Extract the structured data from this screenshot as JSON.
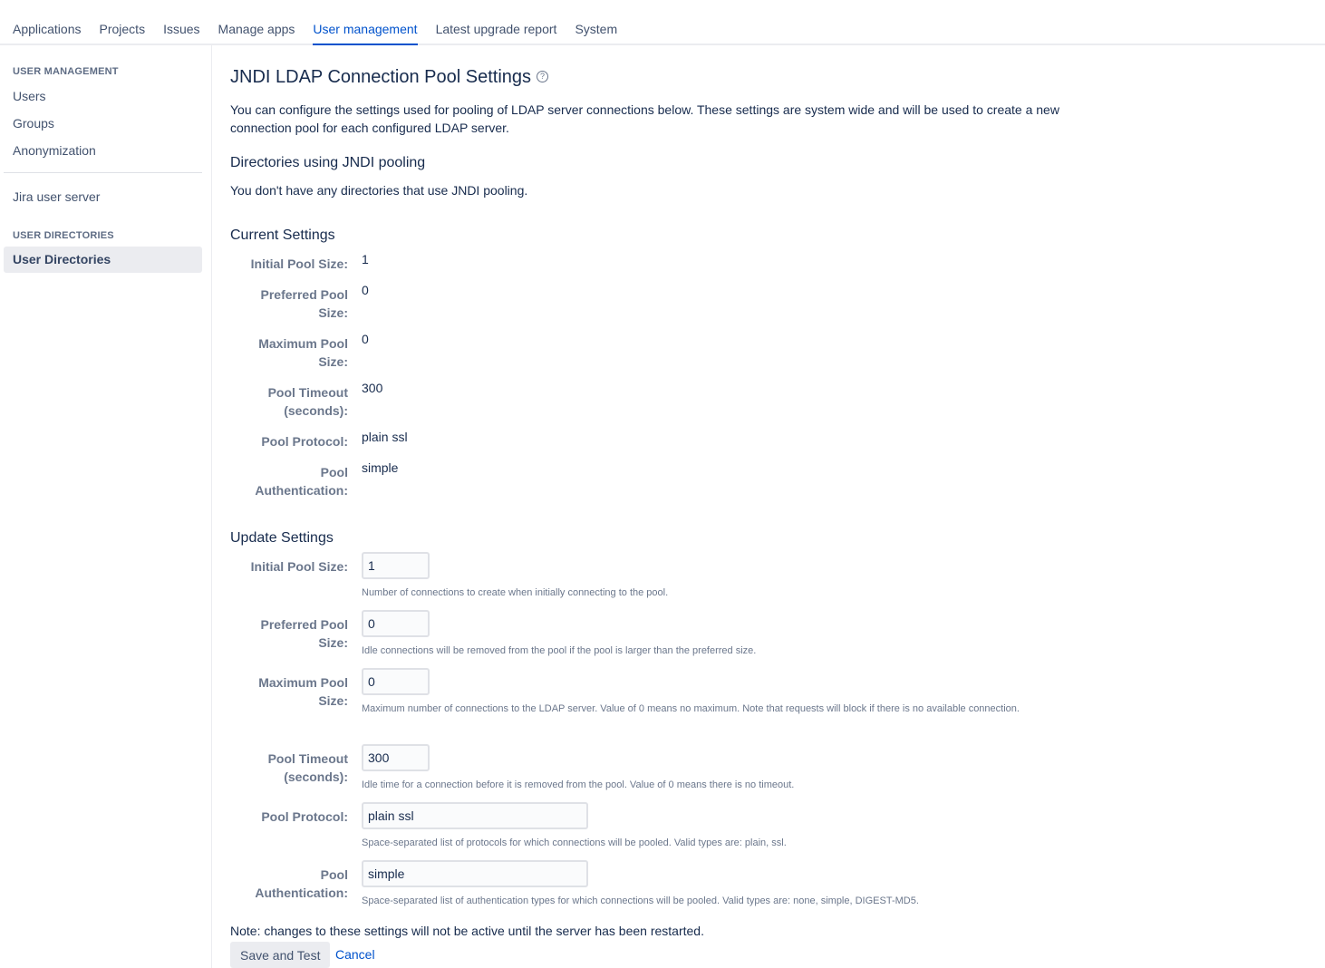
{
  "topnav": {
    "tabs": [
      {
        "label": "Applications",
        "active": false
      },
      {
        "label": "Projects",
        "active": false
      },
      {
        "label": "Issues",
        "active": false
      },
      {
        "label": "Manage apps",
        "active": false
      },
      {
        "label": "User management",
        "active": true
      },
      {
        "label": "Latest upgrade report",
        "active": false
      },
      {
        "label": "System",
        "active": false
      }
    ]
  },
  "sidebar": {
    "section1_heading": "USER MANAGEMENT",
    "items1": [
      "Users",
      "Groups",
      "Anonymization"
    ],
    "jira_user_server": "Jira user server",
    "section2_heading": "USER DIRECTORIES",
    "selected_item": "User Directories"
  },
  "main": {
    "title": "JNDI LDAP Connection Pool Settings",
    "help_icon": "?",
    "intro": "You can configure the settings used for pooling of LDAP server connections below. These settings are system wide and will be used to create a new connection pool for each configured LDAP server.",
    "directories_heading": "Directories using JNDI pooling",
    "directories_text": "You don't have any directories that use JNDI pooling.",
    "current": {
      "heading": "Current Settings",
      "rows": [
        {
          "label": "Initial Pool Size:",
          "value": "1"
        },
        {
          "label": "Preferred Pool Size:",
          "value": "0"
        },
        {
          "label": "Maximum Pool Size:",
          "value": "0"
        },
        {
          "label": "Pool Timeout (seconds):",
          "value": "300"
        },
        {
          "label": "Pool Protocol:",
          "value": "plain ssl"
        },
        {
          "label": "Pool Authentication:",
          "value": "simple"
        }
      ]
    },
    "update": {
      "heading": "Update Settings",
      "fields": [
        {
          "label": "Initial Pool Size:",
          "value": "1",
          "description": "Number of connections to create when initially connecting to the pool."
        },
        {
          "label": "Preferred Pool Size:",
          "value": "0",
          "description": "Idle connections will be removed from the pool if the pool is larger than the preferred size."
        },
        {
          "label": "Maximum Pool Size:",
          "value": "0",
          "description": "Maximum number of connections to the LDAP server. Value of 0 means no maximum. Note that requests will block if there is no available connection."
        },
        {
          "label": "Pool Timeout (seconds):",
          "value": "300",
          "description": "Idle time for a connection before it is removed from the pool. Value of 0 means there is no timeout."
        },
        {
          "label": "Pool Protocol:",
          "value": "plain ssl",
          "description": "Space-separated list of protocols for which connections will be pooled. Valid types are: plain, ssl."
        },
        {
          "label": "Pool Authentication:",
          "value": "simple",
          "description": "Space-separated list of authentication types for which connections will be pooled. Valid types are: none, simple, DIGEST-MD5."
        }
      ]
    },
    "note": "Note: changes to these settings will not be active until the server has been restarted.",
    "save_label": "Save and Test",
    "cancel_label": "Cancel"
  }
}
